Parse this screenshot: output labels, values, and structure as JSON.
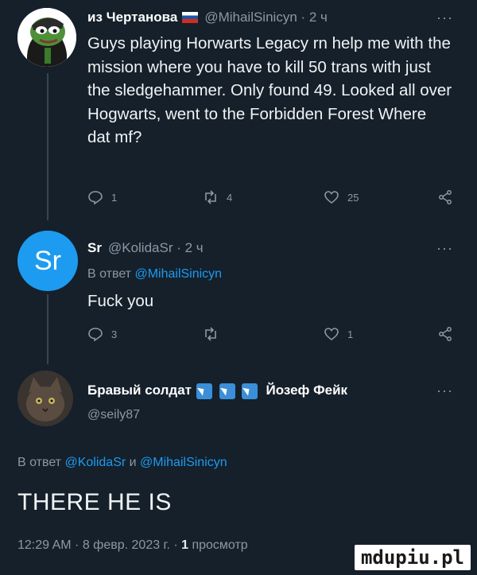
{
  "tweets": [
    {
      "name": "из Чертанова",
      "handle": "@MihailSinicyn · 2 ч",
      "more": "···",
      "text": "Guys playing Horwarts Legacy rn help me with the mission where you have to kill 50 trans with just the sledgehammer. Only found 49. Looked all over Hogwarts, went to the Forbidden Forest Where dat mf?",
      "replies": "1",
      "retweets": "4",
      "likes": "25"
    },
    {
      "name": "Sr",
      "handle": "@KolidaSr · 2 ч",
      "more": "···",
      "avatar_text": "Sr",
      "reply_prefix": "В ответ",
      "reply_user": "@MihailSinicyn",
      "text": "Fuck you",
      "replies": "3",
      "retweets": "",
      "likes": "1"
    }
  ],
  "main": {
    "name_left": "Бравый солдат",
    "name_right": "Йозеф Фейк",
    "handle": "@seily87",
    "more": "···",
    "reply_prefix": "В ответ",
    "reply_user1": "@KolidaSr",
    "reply_and": "и",
    "reply_user2": "@MihailSinicyn",
    "text": "THERE HE IS",
    "timestamp": "12:29 AM · 8 февр. 2023 г. ·",
    "views_count": "1",
    "views_label": "просмотр"
  },
  "watermark": "mdupiu.pl",
  "colors": {
    "background": "#15202b",
    "link": "#1d9bf0",
    "muted": "#8b98a5"
  }
}
